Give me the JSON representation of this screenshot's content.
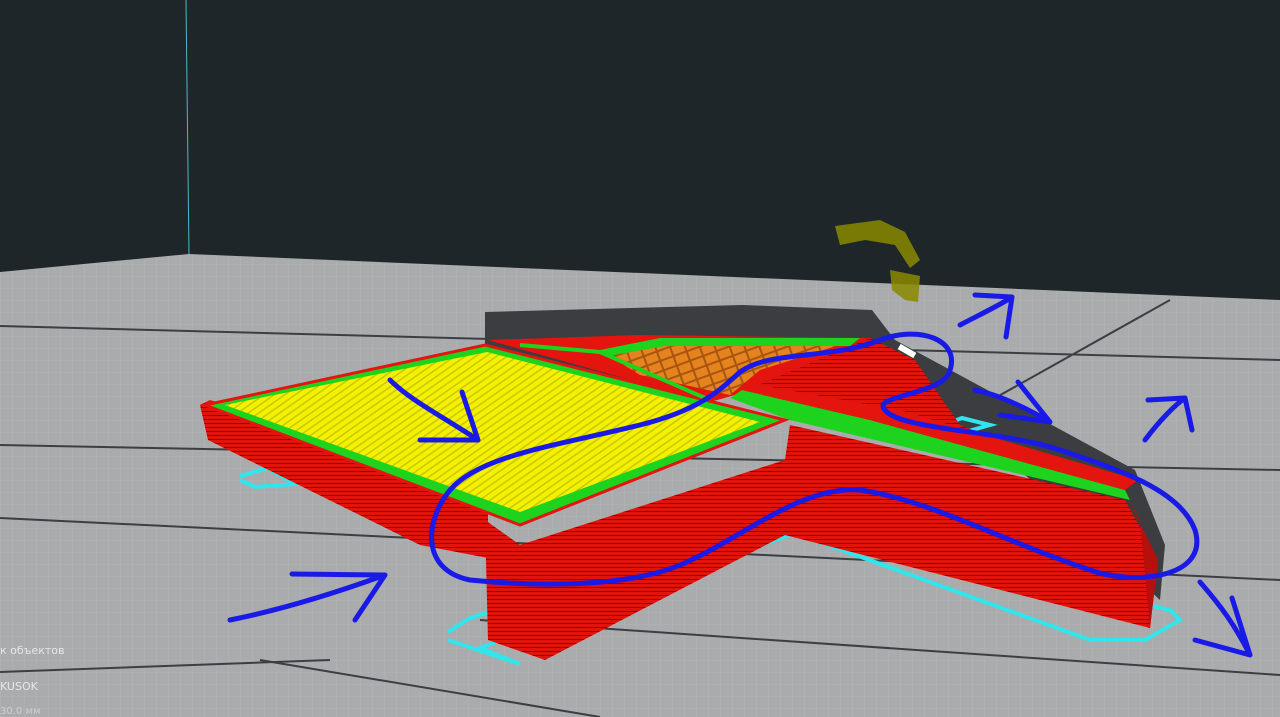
{
  "colors": {
    "background": "#1f262a",
    "build_plate": "#a9abad",
    "plate_grid_line": "#3a3d40",
    "wall_outer": "#e4140f",
    "top_surface": "#f3f000",
    "skin_perimeter": "#1ed31e",
    "infill": "#e5841f",
    "skirt": "#2fe6ec",
    "annotation": "#1a1ae6",
    "nozzle_shadow": "#8a8a00"
  },
  "panel": {
    "objects_label": "к объектов",
    "object_name": "KUSOK",
    "object_size": "30.0 мм"
  }
}
